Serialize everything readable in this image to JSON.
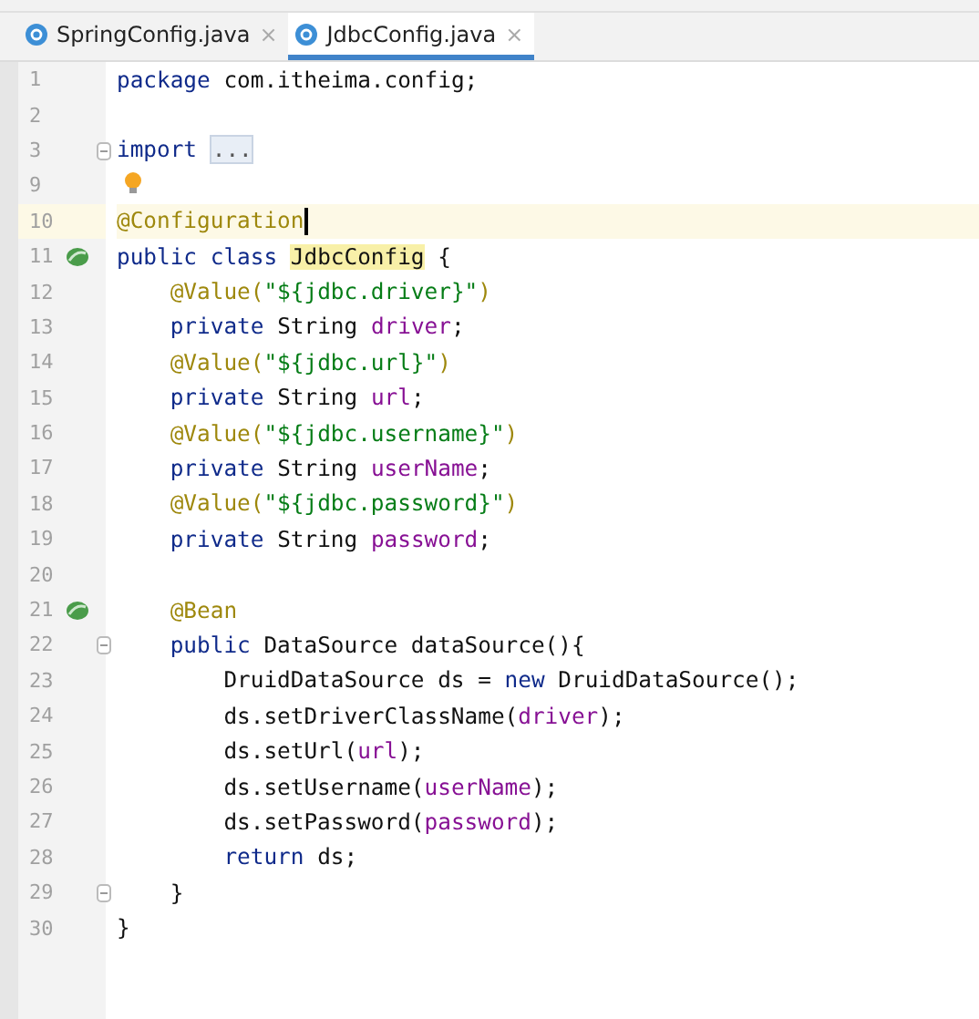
{
  "tabs": [
    {
      "label": "SpringConfig.java",
      "close": "×",
      "selected": false
    },
    {
      "label": "JdbcConfig.java",
      "close": "×",
      "selected": true
    }
  ],
  "lines": [
    {
      "n": "1",
      "tokens": [
        {
          "kind": "keyword",
          "t": "package"
        },
        {
          "kind": "plain",
          "t": " com.itheima.config;"
        }
      ]
    },
    {
      "n": "2"
    },
    {
      "n": "3",
      "fold": true,
      "tokens": [
        {
          "kind": "keyword",
          "t": "import "
        },
        {
          "kind": "folded",
          "t": "..."
        }
      ]
    },
    {
      "n": "9",
      "bulb": true
    },
    {
      "n": "10",
      "current": true,
      "tokens": [
        {
          "kind": "annotation",
          "t": "@Configuration"
        }
      ]
    },
    {
      "n": "11",
      "bean": true,
      "tokens": [
        {
          "kind": "keyword",
          "t": "public class "
        },
        {
          "kind": "highlight",
          "t": "JdbcConfig"
        },
        {
          "kind": "plain",
          "t": " {"
        }
      ]
    },
    {
      "n": "12",
      "tokens": [
        {
          "kind": "annotation",
          "t": "    @Value("
        },
        {
          "kind": "string",
          "t": "\"${jdbc.driver}\""
        },
        {
          "kind": "annotation",
          "t": ")"
        }
      ]
    },
    {
      "n": "13",
      "tokens": [
        {
          "kind": "keyword",
          "t": "    private "
        },
        {
          "kind": "plain",
          "t": "String "
        },
        {
          "kind": "field",
          "t": "driver"
        },
        {
          "kind": "plain",
          "t": ";"
        }
      ]
    },
    {
      "n": "14",
      "tokens": [
        {
          "kind": "annotation",
          "t": "    @Value("
        },
        {
          "kind": "string",
          "t": "\"${jdbc.url}\""
        },
        {
          "kind": "annotation",
          "t": ")"
        }
      ]
    },
    {
      "n": "15",
      "tokens": [
        {
          "kind": "keyword",
          "t": "    private "
        },
        {
          "kind": "plain",
          "t": "String "
        },
        {
          "kind": "field",
          "t": "url"
        },
        {
          "kind": "plain",
          "t": ";"
        }
      ]
    },
    {
      "n": "16",
      "tokens": [
        {
          "kind": "annotation",
          "t": "    @Value("
        },
        {
          "kind": "string",
          "t": "\"${jdbc.username}\""
        },
        {
          "kind": "annotation",
          "t": ")"
        }
      ]
    },
    {
      "n": "17",
      "tokens": [
        {
          "kind": "keyword",
          "t": "    private "
        },
        {
          "kind": "plain",
          "t": "String "
        },
        {
          "kind": "field",
          "t": "userName"
        },
        {
          "kind": "plain",
          "t": ";"
        }
      ]
    },
    {
      "n": "18",
      "tokens": [
        {
          "kind": "annotation",
          "t": "    @Value("
        },
        {
          "kind": "string",
          "t": "\"${jdbc.password}\""
        },
        {
          "kind": "annotation",
          "t": ")"
        }
      ]
    },
    {
      "n": "19",
      "tokens": [
        {
          "kind": "keyword",
          "t": "    private "
        },
        {
          "kind": "plain",
          "t": "String "
        },
        {
          "kind": "field",
          "t": "password"
        },
        {
          "kind": "plain",
          "t": ";"
        }
      ]
    },
    {
      "n": "20"
    },
    {
      "n": "21",
      "bean": true,
      "tokens": [
        {
          "kind": "annotation",
          "t": "    @Bean"
        }
      ]
    },
    {
      "n": "22",
      "fold": true,
      "tokens": [
        {
          "kind": "keyword",
          "t": "    public "
        },
        {
          "kind": "plain",
          "t": "DataSource dataSource(){"
        }
      ]
    },
    {
      "n": "23",
      "tokens": [
        {
          "kind": "plain",
          "t": "        DruidDataSource ds = "
        },
        {
          "kind": "keyword",
          "t": "new"
        },
        {
          "kind": "plain",
          "t": " DruidDataSource();"
        }
      ]
    },
    {
      "n": "24",
      "tokens": [
        {
          "kind": "plain",
          "t": "        ds.setDriverClassName("
        },
        {
          "kind": "field",
          "t": "driver"
        },
        {
          "kind": "plain",
          "t": ");"
        }
      ]
    },
    {
      "n": "25",
      "tokens": [
        {
          "kind": "plain",
          "t": "        ds.setUrl("
        },
        {
          "kind": "field",
          "t": "url"
        },
        {
          "kind": "plain",
          "t": ");"
        }
      ]
    },
    {
      "n": "26",
      "tokens": [
        {
          "kind": "plain",
          "t": "        ds.setUsername("
        },
        {
          "kind": "field",
          "t": "userName"
        },
        {
          "kind": "plain",
          "t": ");"
        }
      ]
    },
    {
      "n": "27",
      "tokens": [
        {
          "kind": "plain",
          "t": "        ds.setPassword("
        },
        {
          "kind": "field",
          "t": "password"
        },
        {
          "kind": "plain",
          "t": ");"
        }
      ]
    },
    {
      "n": "28",
      "tokens": [
        {
          "kind": "keyword",
          "t": "        return"
        },
        {
          "kind": "plain",
          "t": " ds;"
        }
      ]
    },
    {
      "n": "29",
      "fold": true,
      "tokens": [
        {
          "kind": "plain",
          "t": "    }"
        }
      ]
    },
    {
      "n": "30",
      "tokens": [
        {
          "kind": "plain",
          "t": "}"
        }
      ]
    }
  ]
}
